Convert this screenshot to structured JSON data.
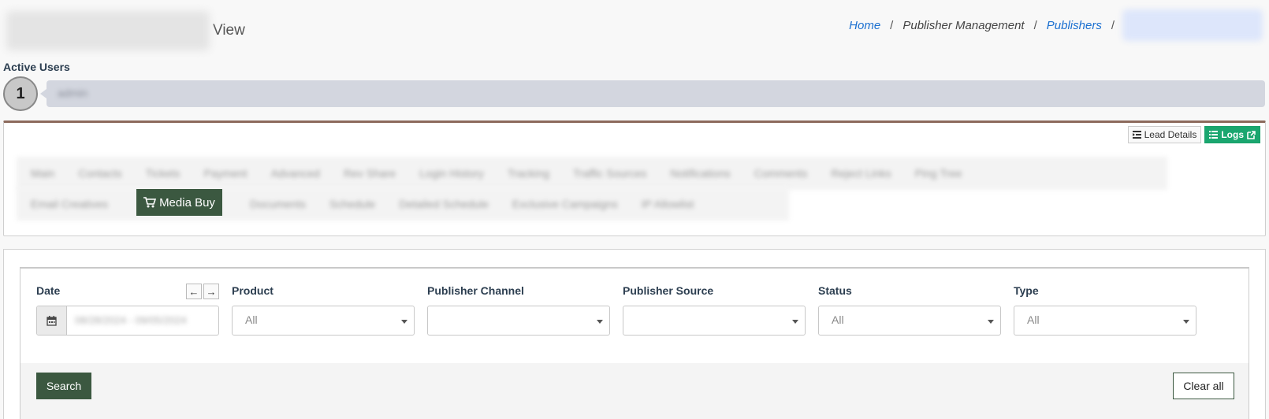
{
  "header": {
    "title_suffix": "View"
  },
  "breadcrumb": {
    "home": "Home",
    "publisher_management": "Publisher Management",
    "publishers": "Publishers",
    "separator": "/"
  },
  "active_users": {
    "label": "Active Users",
    "count": "1",
    "user_name": "admin"
  },
  "tabs": {
    "lead_details": "Lead Details",
    "logs": "Logs",
    "row1": [
      "Main",
      "Contacts",
      "Tickets",
      "Payment",
      "Advanced",
      "Rev Share",
      "Login History",
      "Tracking",
      "Traffic Sources",
      "Notifications",
      "Comments",
      "Reject Links",
      "Ping Tree"
    ],
    "row2": [
      "Email Creatives",
      "Documents",
      "Schedule",
      "Detailed Schedule",
      "Exclusive Campaigns",
      "IP Allowlist"
    ],
    "active": "Media Buy"
  },
  "filters": {
    "date_label": "Date",
    "date_value": "08/28/2024 - 09/05/2024",
    "product_label": "Product",
    "product_value": "All",
    "channel_label": "Publisher Channel",
    "channel_value": "",
    "source_label": "Publisher Source",
    "source_value": "",
    "status_label": "Status",
    "status_value": "All",
    "type_label": "Type",
    "type_value": "All",
    "search_button": "Search",
    "clear_button": "Clear all"
  },
  "colors": {
    "primary_green": "#3b5840",
    "logs_green": "#1aa66f",
    "link_blue": "#1a6fd0"
  }
}
